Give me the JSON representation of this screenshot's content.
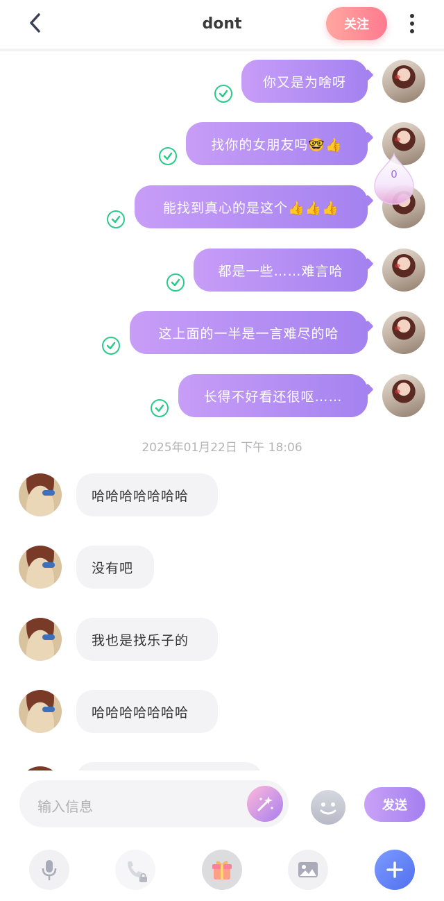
{
  "header": {
    "title": "dont",
    "follow_label": "关注"
  },
  "float_counter": "0",
  "messages_out": [
    {
      "text": "你又是为啥呀"
    },
    {
      "text": "找你的女朋友吗🤓👍"
    },
    {
      "text": "能找到真心的是这个👍👍👍"
    },
    {
      "text": "都是一些……难言哈"
    },
    {
      "text": "这上面的一半是一言难尽的哈"
    },
    {
      "text": "长得不好看还很呕……"
    }
  ],
  "timestamp": "2025年01月22日 下午 18:06",
  "messages_in": [
    {
      "text": "哈哈哈哈哈哈哈"
    },
    {
      "text": "没有吧"
    },
    {
      "text": "我也是找乐子的"
    },
    {
      "text": "哈哈哈哈哈哈哈"
    }
  ],
  "input": {
    "placeholder": "输入信息",
    "send_label": "发送"
  },
  "toolbar": {
    "icons": [
      "microphone-icon",
      "phone-locked-icon",
      "gift-icon",
      "image-icon",
      "plus-icon"
    ]
  },
  "colors": {
    "outgoing_bubble": "#b08df3",
    "incoming_bubble": "#f3f3f6",
    "read_check": "#2bc98a",
    "follow_button": "#ff8e96",
    "plus_button": "#5f7cf6"
  }
}
